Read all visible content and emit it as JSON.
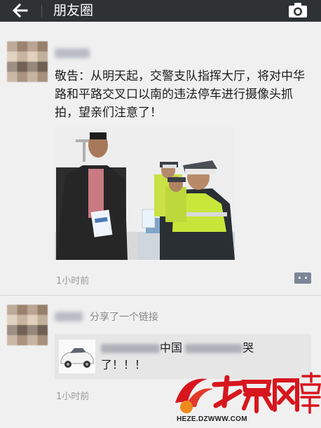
{
  "header": {
    "title": "朋友圈",
    "back_icon": "arrow-left-icon",
    "camera_icon": "camera-icon",
    "bar_color": "#2e3233"
  },
  "posts": [
    {
      "text": "敬告：从明天起，交警支队指挥大厅，将对中华路和平路交叉口以南的违法停车进行摄像头抓拍，望亲们注意了！",
      "photo_icon": "traffic-police-photo",
      "time": "1小时前"
    },
    {
      "action": "分享了一个链接",
      "link": {
        "title_visible_1": "中国",
        "title_visible_2": "哭",
        "title_line2": "了！！！",
        "thumb_icon": "white-car-icon"
      },
      "time": "1小时前"
    }
  ],
  "watermark": {
    "logo_icon": "dazhongwang-logo",
    "site": "HEZE.DZWWW.COM",
    "accent_color": "#d7161e"
  }
}
